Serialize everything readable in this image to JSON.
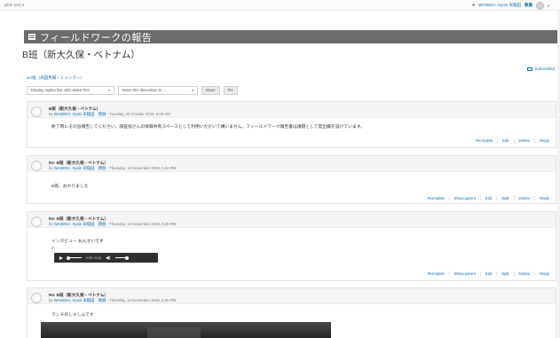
{
  "topbar": {
    "language": "glish (en) ▾",
    "user_name": "WASEDA, Kyoin 早稲田",
    "user_role": "教員"
  },
  "page": {
    "header_title": "フィールドワークの報告",
    "course_title": "B班（新大久保・ベトナム）",
    "subscribed_label": "Subscribed",
    "crumb": "◂ A班（高田馬場・ミャンマー）"
  },
  "controls": {
    "display_mode": "Display replies flat, with oldest first",
    "move_select": "Move this discussion to ...",
    "move_button": "Move",
    "pin_button": "Pin"
  },
  "posts": [
    {
      "subject": "B班（新大久保・ベトナム）",
      "by": "by",
      "author": "WASEDA, Kyoin 早稲田　教員",
      "date": " - Tuesday, 22 October 2019, 6:03 AM",
      "message": "終了時にその旨報告してください。調査協さんの情報共有スペースとして利用いただいて構いません。フィールドワーク報告書は課題として提出欄を設けています。",
      "actions": [
        "Permalink",
        "Edit",
        "Delete",
        "Reply"
      ]
    },
    {
      "subject": "Re: B班（新大久保・ベトナム）",
      "by": "by",
      "author": "WASEDA, Kyoin 早稲田　教員",
      "date": " - Thursday, 14 November 2019, 5:24 PM",
      "message": "B班、おわりました",
      "actions": [
        "Permalink",
        "Show parent",
        "Edit",
        "Split",
        "Delete",
        "Reply"
      ]
    },
    {
      "subject": "Re: B班（新大久保・ベトナム）",
      "by": "by",
      "author": "WASEDA, Kyoin 早稲田　教員",
      "date": " - Thursday, 14 November 2019, 5:25 PM",
      "message": "インタビュー おんせいです",
      "audio_link": "m",
      "audio_time": "0:00 / 0:00",
      "actions": [
        "Permalink",
        "Show parent",
        "Edit",
        "Split",
        "Delete",
        "Reply"
      ]
    },
    {
      "subject": "Re: B班（新大久保・ベトナム）",
      "by": "by",
      "author": "WASEDA, Kyoin 早稲田　教員",
      "date": " - Thursday, 14 November 2019, 5:26 PM",
      "message": "ランチのしゃしんです"
    }
  ]
}
